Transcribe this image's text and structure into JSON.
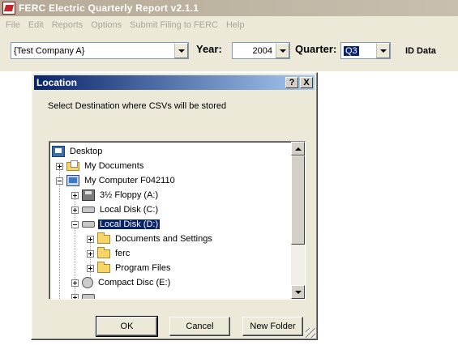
{
  "app": {
    "title": "FERC Electric Quarterly Report v2.1.1"
  },
  "menu": [
    "File",
    "Edit",
    "Reports",
    "Options",
    "Submit Filing to FERC",
    "Help"
  ],
  "toolbar": {
    "company": "{Test Company A}",
    "year_label": "Year:",
    "year_value": "2004",
    "quarter_label": "Quarter:",
    "quarter_value": "Q3",
    "id_data_label": "ID Data"
  },
  "dialog": {
    "title": "Location",
    "help_button": "?",
    "close_button": "X",
    "message": "Select Destination where CSVs will be stored",
    "tree": [
      {
        "label": "Desktop",
        "icon": "desktop-icon",
        "level": 0
      },
      {
        "label": "My Documents",
        "icon": "my-documents-icon",
        "level": 1
      },
      {
        "label": "My Computer F042110",
        "icon": "computer-icon",
        "level": 1
      },
      {
        "label": "3½ Floppy (A:)",
        "icon": "floppy-icon",
        "level": 2
      },
      {
        "label": "Local Disk (C:)",
        "icon": "disk-icon",
        "level": 2
      },
      {
        "label": "Local Disk (D:)",
        "icon": "disk-icon",
        "level": 2,
        "selected": true
      },
      {
        "label": "Documents and Settings",
        "icon": "folder-icon",
        "level": 3
      },
      {
        "label": "ferc",
        "icon": "folder-icon",
        "level": 3
      },
      {
        "label": "Program Files",
        "icon": "folder-icon",
        "level": 3
      },
      {
        "label": "Compact Disc (E:)",
        "icon": "cd-icon",
        "level": 2
      }
    ],
    "buttons": {
      "ok": "OK",
      "cancel": "Cancel",
      "new_folder": "New Folder"
    }
  },
  "colors": {
    "selection": "#0a246a",
    "dialog_title": "#0a246a",
    "app_title_inactive": "#b5aa97"
  }
}
